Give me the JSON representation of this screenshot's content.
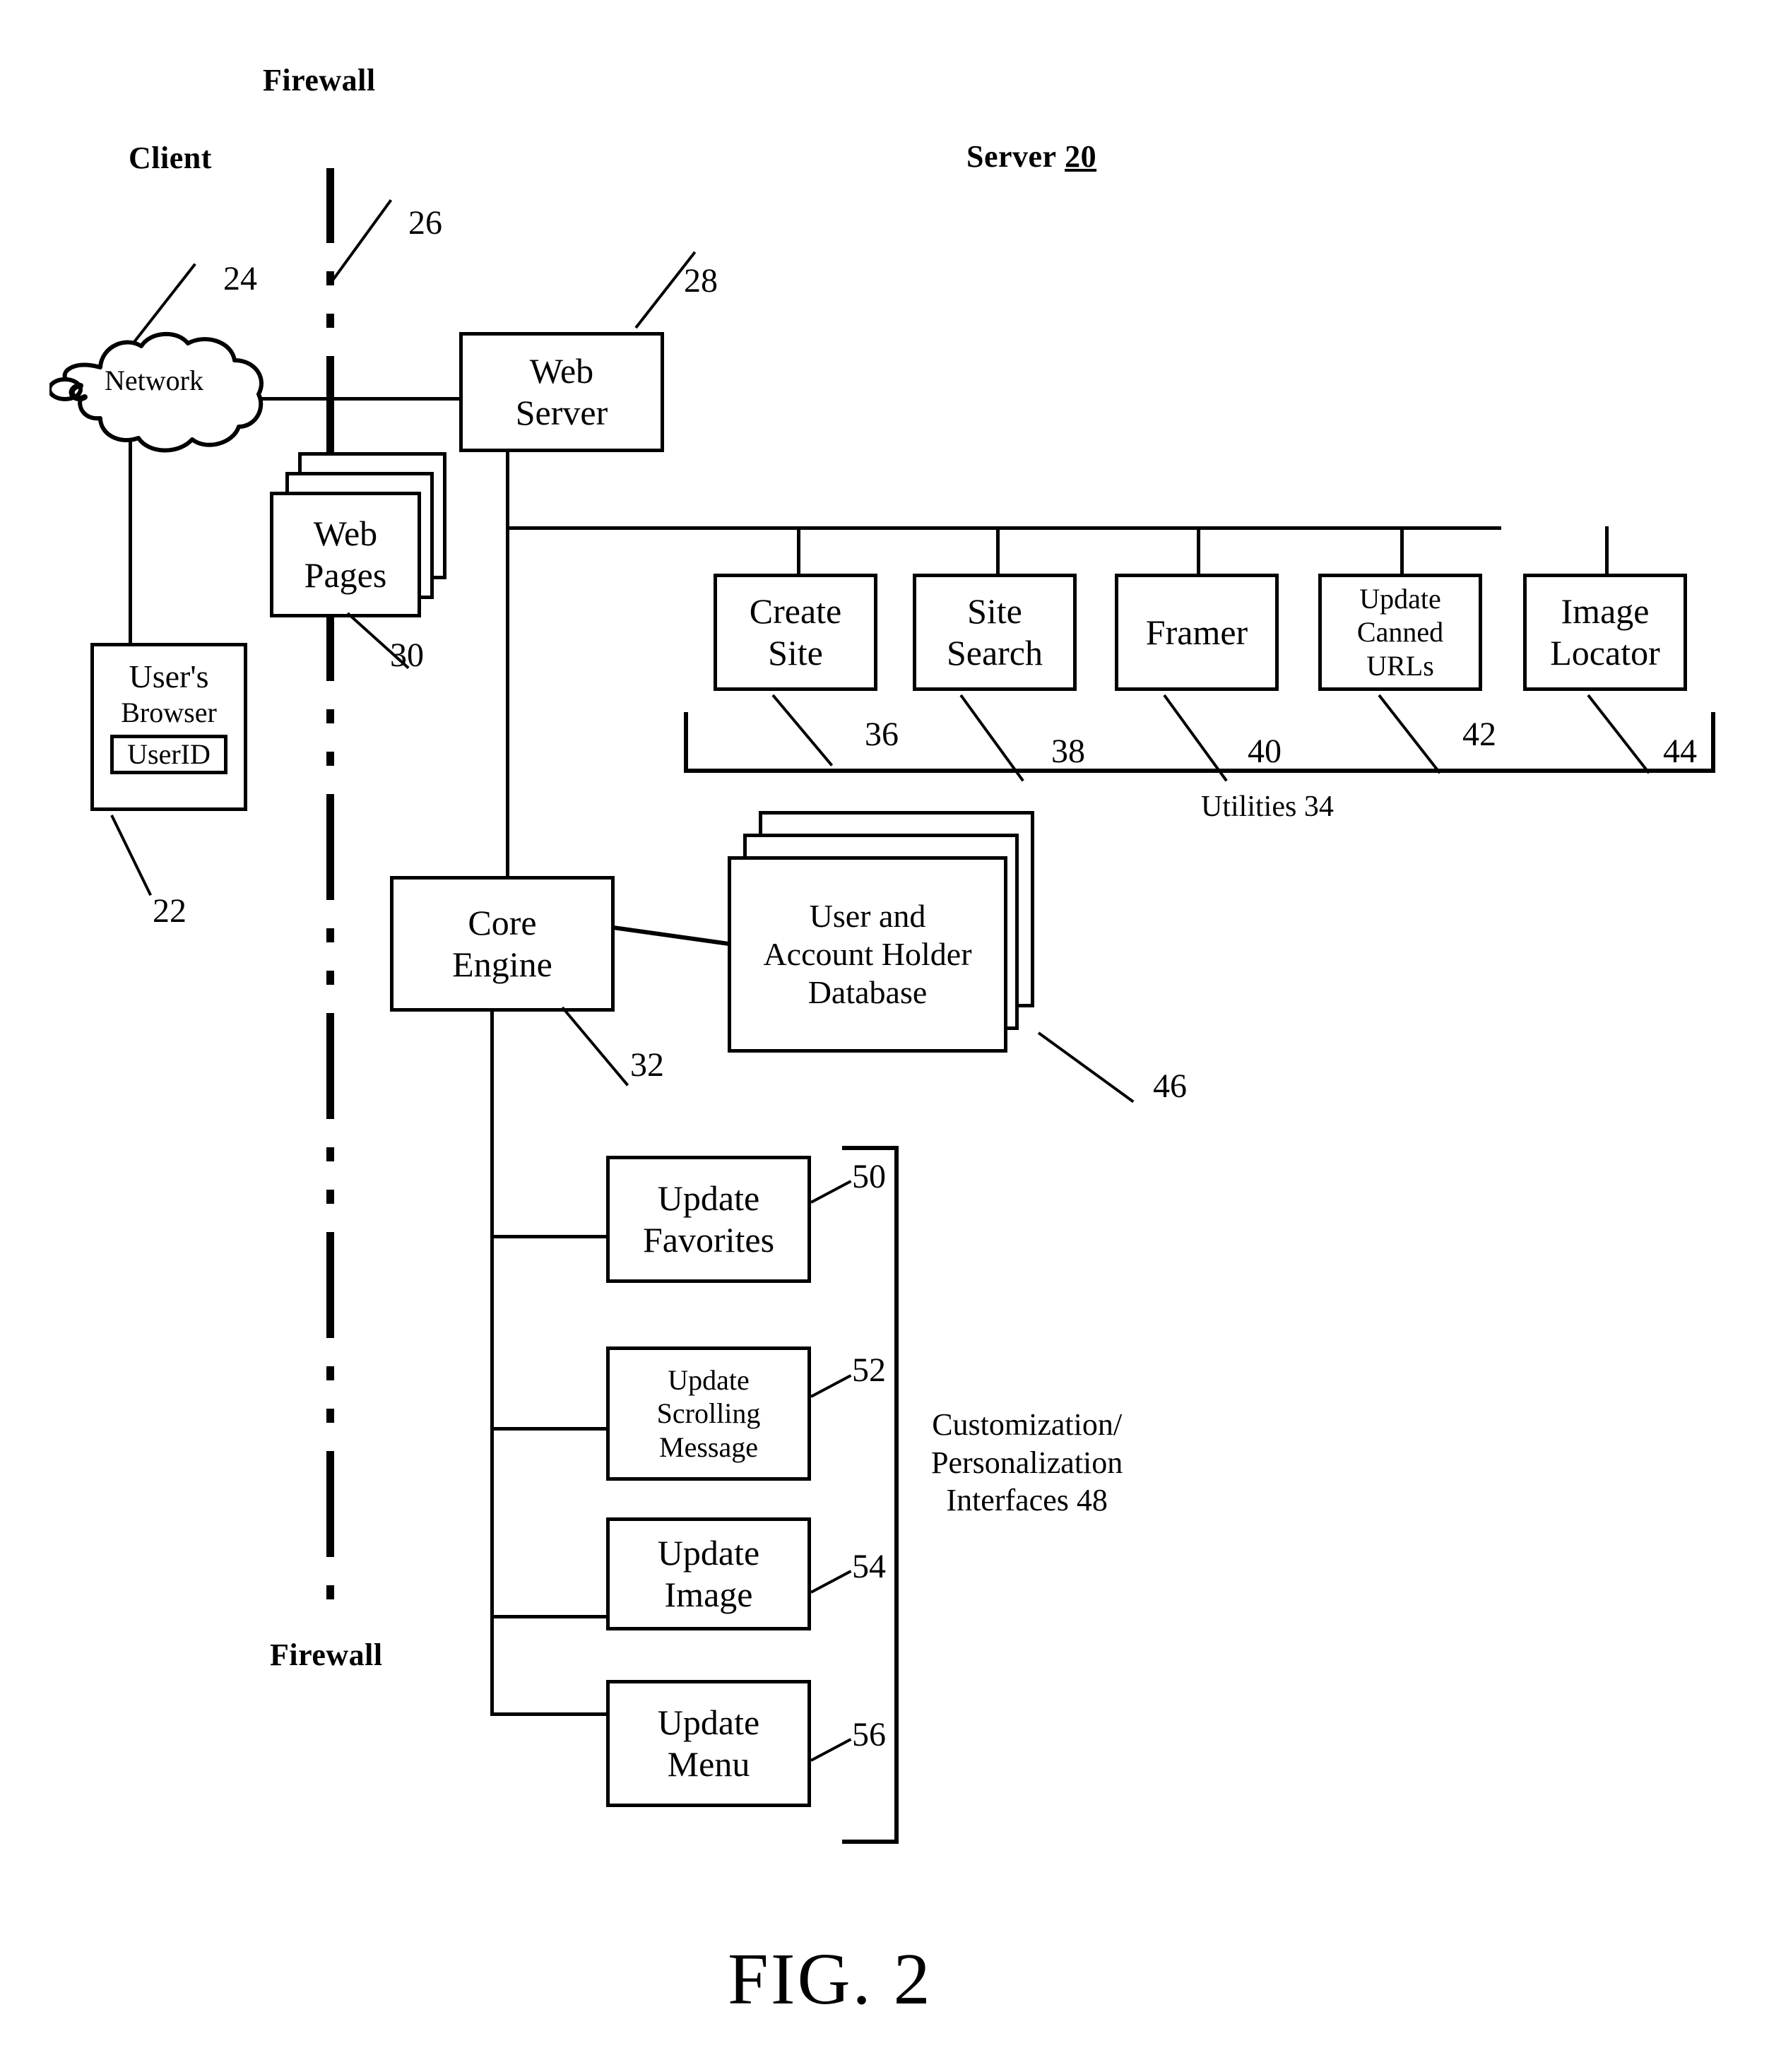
{
  "figure": {
    "caption": "FIG. 2"
  },
  "labels": {
    "firewall_top": "Firewall",
    "firewall_bottom": "Firewall",
    "client": "Client",
    "server_word": "Server",
    "server_number": "20",
    "utilities_group": "Utilities 34",
    "customization_group_line1": "Customization/",
    "customization_group_line2": "Personalization",
    "customization_group_line3": "Interfaces 48"
  },
  "nodes": {
    "network": {
      "label": "Network",
      "ref": "24"
    },
    "firewall_line": {
      "ref": "26"
    },
    "web_server": {
      "line1": "Web",
      "line2": "Server",
      "ref": "28"
    },
    "web_pages": {
      "line1": "Web",
      "line2": "Pages",
      "ref": "30"
    },
    "users_browser": {
      "line1": "User's",
      "line2": "Browser",
      "field": "UserID",
      "ref": "22"
    },
    "core_engine": {
      "line1": "Core",
      "line2": "Engine",
      "ref": "32"
    },
    "database": {
      "line1": "User and",
      "line2": "Account Holder",
      "line3": "Database",
      "ref": "46"
    }
  },
  "utilities": [
    {
      "line1": "Create",
      "line2": "Site",
      "line3": "",
      "ref": "36"
    },
    {
      "line1": "Site",
      "line2": "Search",
      "line3": "",
      "ref": "38"
    },
    {
      "line1": "Framer",
      "line2": "",
      "line3": "",
      "ref": "40"
    },
    {
      "line1": "Update",
      "line2": "Canned",
      "line3": "URLs",
      "ref": "42"
    },
    {
      "line1": "Image",
      "line2": "Locator",
      "line3": "",
      "ref": "44"
    }
  ],
  "customization_interfaces": [
    {
      "line1": "Update",
      "line2": "Favorites",
      "line3": "",
      "ref": "50"
    },
    {
      "line1": "Update",
      "line2": "Scrolling",
      "line3": "Message",
      "ref": "52"
    },
    {
      "line1": "Update",
      "line2": "Image",
      "line3": "",
      "ref": "54"
    },
    {
      "line1": "Update",
      "line2": "Menu",
      "line3": "",
      "ref": "56"
    }
  ],
  "colors": {
    "ink": "#000000",
    "paper": "#ffffff"
  }
}
